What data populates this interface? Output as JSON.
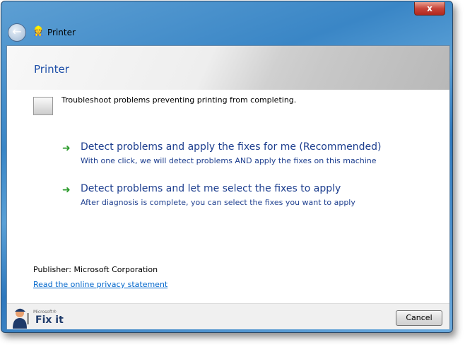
{
  "window": {
    "title": "Printer",
    "close_label": "x"
  },
  "header": {
    "title": "Printer"
  },
  "description": "Troubleshoot problems preventing printing from completing.",
  "options": [
    {
      "title": "Detect problems and apply the fixes for me (Recommended)",
      "subtitle": "With one click, we will detect problems AND apply the fixes on this machine"
    },
    {
      "title": "Detect problems and let me select the fixes to apply",
      "subtitle": "After diagnosis is complete, you can select the fixes you want to apply"
    }
  ],
  "publisher": "Publisher: Microsoft Corporation",
  "privacy_link": "Read the online privacy statement",
  "footer": {
    "brand_small": "Microsoft®",
    "brand": "Fix it",
    "cancel": "Cancel"
  },
  "colors": {
    "heading": "#1e4fa8",
    "link": "#0066cc",
    "arrow": "#2a9a2a"
  }
}
